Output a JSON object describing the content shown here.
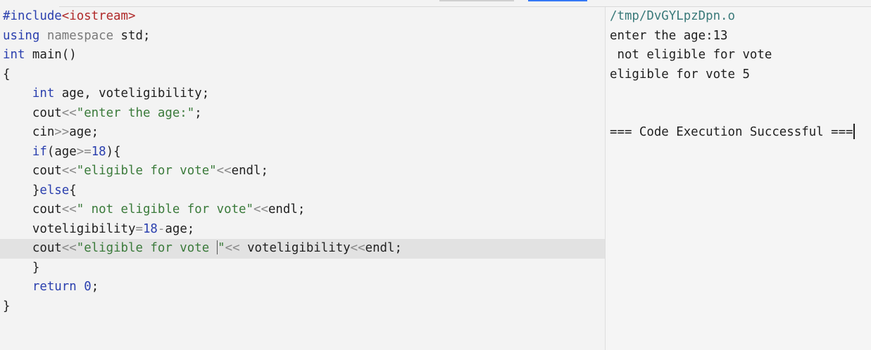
{
  "editor": {
    "lines": [
      [
        [
          "inc",
          "#include"
        ],
        [
          "hdr",
          "<iostream>"
        ]
      ],
      [
        [
          "kw",
          "using"
        ],
        [
          "plain",
          " "
        ],
        [
          "ns",
          "namespace"
        ],
        [
          "plain",
          " std;"
        ]
      ],
      [
        [
          "type",
          "int"
        ],
        [
          "plain",
          " main()"
        ]
      ],
      [
        [
          "plain",
          "{"
        ]
      ],
      [
        [
          "plain",
          "    "
        ],
        [
          "type",
          "int"
        ],
        [
          "plain",
          " age, voteligibility;"
        ]
      ],
      [
        [
          "plain",
          "    cout"
        ],
        [
          "op",
          "<<"
        ],
        [
          "str",
          "\"enter the age:\""
        ],
        [
          "plain",
          ";"
        ]
      ],
      [
        [
          "plain",
          "    cin"
        ],
        [
          "op",
          ">>"
        ],
        [
          "plain",
          "age;"
        ]
      ],
      [
        [
          "plain",
          "    "
        ],
        [
          "kw",
          "if"
        ],
        [
          "plain",
          "(age"
        ],
        [
          "op",
          ">="
        ],
        [
          "num",
          "18"
        ],
        [
          "plain",
          "){"
        ]
      ],
      [
        [
          "plain",
          "    cout"
        ],
        [
          "op",
          "<<"
        ],
        [
          "str",
          "\"eligible for vote\""
        ],
        [
          "op",
          "<<"
        ],
        [
          "plain",
          "endl;"
        ]
      ],
      [
        [
          "plain",
          "    }"
        ],
        [
          "kw",
          "else"
        ],
        [
          "plain",
          "{"
        ]
      ],
      [
        [
          "plain",
          "    cout"
        ],
        [
          "op",
          "<<"
        ],
        [
          "str",
          "\" not eligible for vote\""
        ],
        [
          "op",
          "<<"
        ],
        [
          "plain",
          "endl;"
        ]
      ],
      [
        [
          "plain",
          "    voteligibility"
        ],
        [
          "op",
          "="
        ],
        [
          "num",
          "18"
        ],
        [
          "op",
          "-"
        ],
        [
          "plain",
          "age;"
        ]
      ],
      [
        [
          "plain",
          "    cout"
        ],
        [
          "op",
          "<<"
        ],
        [
          "str",
          "\"eligible for vote "
        ],
        [
          "cursor",
          ""
        ],
        [
          "str",
          "\""
        ],
        [
          "op",
          "<<"
        ],
        [
          "plain",
          " voteligibility"
        ],
        [
          "op",
          "<<"
        ],
        [
          "plain",
          "endl;"
        ]
      ],
      [
        [
          "plain",
          "    }"
        ]
      ],
      [
        [
          "plain",
          "    "
        ],
        [
          "kw",
          "return"
        ],
        [
          "plain",
          " "
        ],
        [
          "num",
          "0"
        ],
        [
          "plain",
          ";"
        ]
      ],
      [
        [
          "plain",
          "}"
        ]
      ]
    ],
    "active_line": 12
  },
  "output": {
    "path": "/tmp/DvGYLpzDpn.o",
    "line1": "enter the age:13",
    "line2": " not eligible for vote",
    "line3": "eligible for vote 5",
    "success": "=== Code Execution Successful ==="
  }
}
